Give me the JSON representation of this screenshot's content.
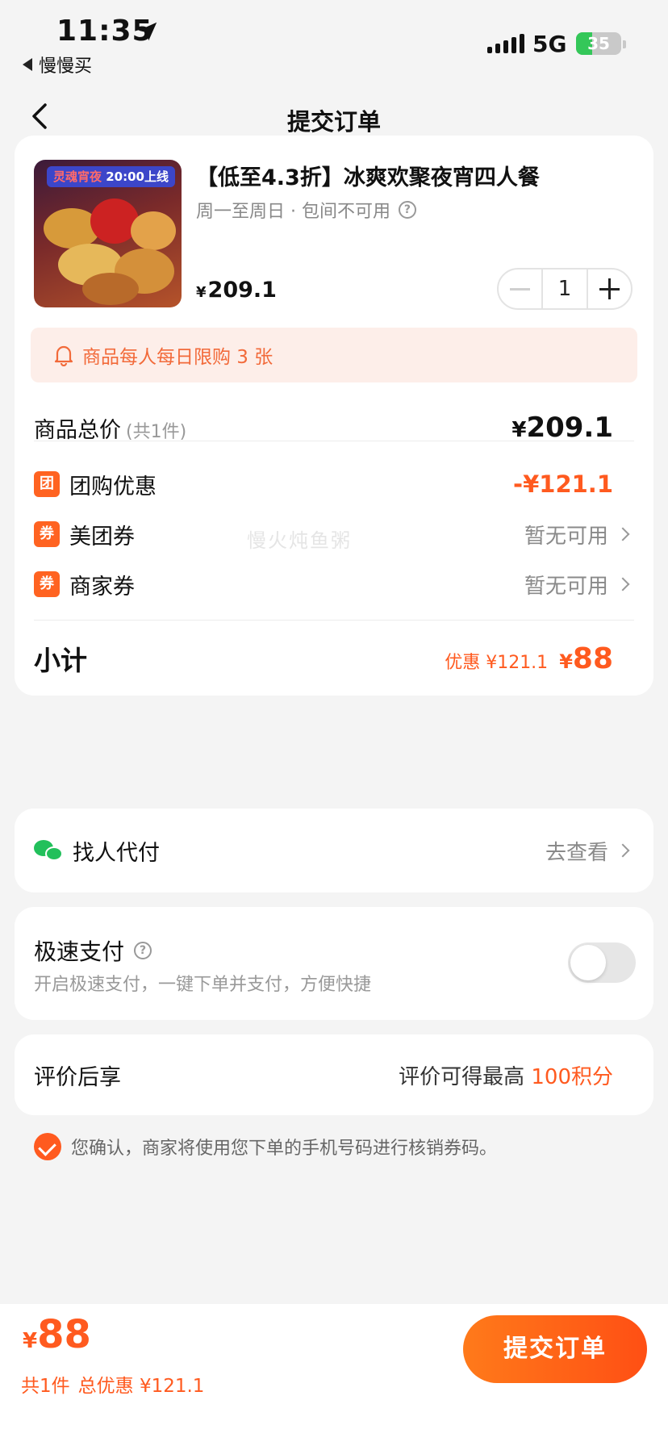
{
  "status_bar": {
    "time": "11:35",
    "back_app": "慢慢买",
    "network": "5G",
    "battery": "35",
    "battery_level": 0.35
  },
  "nav": {
    "title": "提交订单"
  },
  "product": {
    "image_banner_left": "灵魂宵夜",
    "image_banner_right": "20:00上线",
    "title": "【低至4.3折】冰爽欢聚夜宵四人餐",
    "subtitle": "周一至周日 · 包间不可用",
    "currency": "¥",
    "price": "209.1",
    "quantity": "1"
  },
  "limit_notice": "商品每人每日限购 3 张",
  "summary": {
    "total_label": "商品总价",
    "total_count": "(共1件)",
    "currency": "¥",
    "total_value": "209.1",
    "discounts": [
      {
        "badge": "团",
        "label": "团购优惠",
        "value": "-¥121.1"
      },
      {
        "badge": "券",
        "label": "美团券",
        "value": "暂无可用"
      },
      {
        "badge": "券",
        "label": "商家券",
        "value": "暂无可用"
      }
    ],
    "watermark": "慢火炖鱼粥",
    "subtotal_label": "小计",
    "subtotal_discount": "优惠 ¥121.1",
    "subtotal_value": "88"
  },
  "pay_for_me": {
    "label": "找人代付",
    "action": "去查看"
  },
  "fast_pay": {
    "title": "极速支付",
    "description": "开启极速支付，一键下单并支付，方便快捷",
    "enabled": false
  },
  "review": {
    "label": "评价后享",
    "text": "评价可得最高",
    "highlight": "100积分"
  },
  "confirm_text": "您确认，商家将使用您下单的手机号码进行核销券码。",
  "bottom": {
    "currency": "¥",
    "amount": "88",
    "count": "共1件",
    "total_discount": "总优惠 ¥121.1",
    "submit_label": "提交订单"
  },
  "colors": {
    "accent": "#ff5a1f",
    "badge": "#ff6321",
    "notice_bg": "#fdeee9",
    "wechat": "#22c05b",
    "page_bg": "#f4f4f4"
  }
}
